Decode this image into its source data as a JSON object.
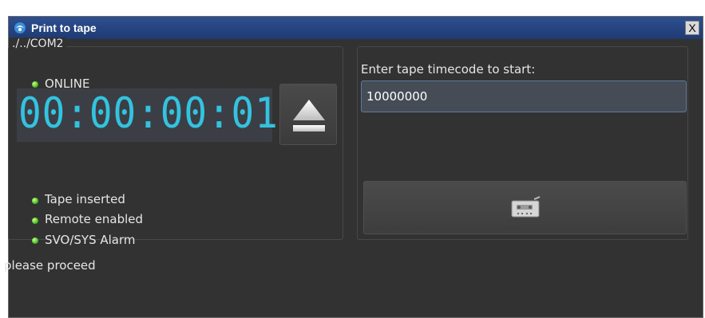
{
  "window": {
    "title": "Print to tape",
    "close_label": "X"
  },
  "device": {
    "port": "./../COM2",
    "online_label": "ONLINE",
    "timecode": "00:00:00:01",
    "status_items": [
      {
        "label": "Tape inserted"
      },
      {
        "label": "Remote enabled"
      },
      {
        "label": "SVO/SYS Alarm"
      }
    ]
  },
  "tape_start": {
    "label": "Enter tape timecode to start:",
    "value": "10000000"
  },
  "footer": {
    "message": "please proceed"
  },
  "colors": {
    "led": "#4bbf24",
    "timecode": "#33c3e0",
    "background": "#323232"
  },
  "icons": {
    "app": "app-icon",
    "eject": "eject-icon",
    "print": "tape-print-icon"
  }
}
